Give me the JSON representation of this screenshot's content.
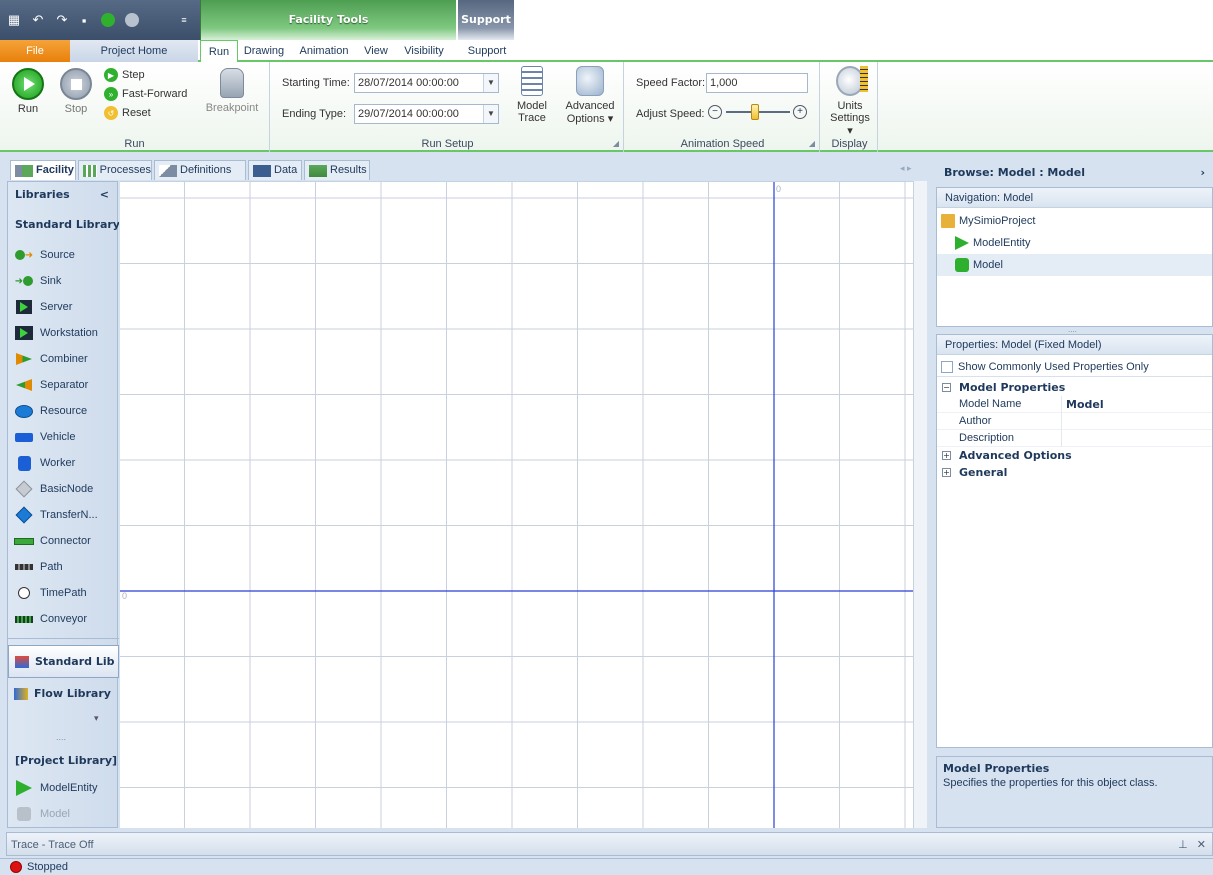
{
  "context_tabs": {
    "facility_tools": "Facility Tools",
    "support": "Support"
  },
  "ribbon_tabs": {
    "file": "File",
    "project_home": "Project Home",
    "run": "Run",
    "drawing": "Drawing",
    "animation": "Animation",
    "view": "View",
    "visibility": "Visibility",
    "support": "Support"
  },
  "ribbon": {
    "run_group": {
      "label": "Run",
      "run": "Run",
      "stop": "Stop",
      "step": "Step",
      "fast_forward": "Fast-Forward",
      "reset": "Reset",
      "breakpoint": "Breakpoint"
    },
    "run_setup": {
      "label": "Run Setup",
      "starting_time_label": "Starting Time:",
      "starting_time_value": "28/07/2014 00:00:00",
      "ending_type_label": "Ending Type:",
      "ending_type_value": "29/07/2014 00:00:00",
      "model_trace_line1": "Model",
      "model_trace_line2": "Trace",
      "advanced_options_line1": "Advanced",
      "advanced_options_line2": "Options ▾"
    },
    "animation_speed": {
      "label": "Animation Speed",
      "speed_factor_label": "Speed Factor:",
      "speed_factor_value": "1,000",
      "adjust_speed_label": "Adjust Speed:",
      "slider_fraction": 0.45
    },
    "display": {
      "label": "Display",
      "units_line1": "Units",
      "units_line2": "Settings ▾"
    }
  },
  "document_tabs": [
    "Facility",
    "Processes",
    "Definitions",
    "Data",
    "Results"
  ],
  "libraries": {
    "header": "Libraries",
    "collapse": "<",
    "standard_title": "Standard Library",
    "items": [
      "Source",
      "Sink",
      "Server",
      "Workstation",
      "Combiner",
      "Separator",
      "Resource",
      "Vehicle",
      "Worker",
      "BasicNode",
      "TransferN...",
      "Connector",
      "Path",
      "TimePath",
      "Conveyor"
    ],
    "selectors": [
      "Standard Lib",
      "Flow Library"
    ],
    "more": "▾",
    "grip": "....",
    "project_title": "[Project Library]",
    "project_items": [
      "ModelEntity",
      "Model"
    ]
  },
  "canvas": {
    "origin_label_top": "0",
    "origin_label_left": "0"
  },
  "browse": {
    "header": "Browse: Model : Model",
    "chevron": "›",
    "navigation_title": "Navigation: Model",
    "tree": [
      "MySimioProject",
      "ModelEntity",
      "Model"
    ],
    "grip": "....",
    "properties_title": "Properties: Model (Fixed Model)",
    "show_common": "Show Commonly Used Properties Only",
    "categories": [
      {
        "name": "Model Properties",
        "expanded": "⊟"
      },
      {
        "name": "Advanced Options",
        "expanded": "⊞"
      },
      {
        "name": "General",
        "expanded": "⊞"
      }
    ],
    "properties": [
      {
        "key": "Model Name",
        "value": "Model"
      },
      {
        "key": "Author",
        "value": ""
      },
      {
        "key": "Description",
        "value": ""
      }
    ],
    "description_title": "Model Properties",
    "description_text": "Specifies the properties for this object class."
  },
  "trace": {
    "text": "Trace - Trace Off",
    "pin": "⊥",
    "close": "✕"
  },
  "status": {
    "text": "Stopped"
  },
  "colors": {
    "ribbon_accent": "#68c868",
    "grid_line": "#c8d1dc",
    "axis_line": "#2a3fd6",
    "file_tab": "#e8800b"
  }
}
